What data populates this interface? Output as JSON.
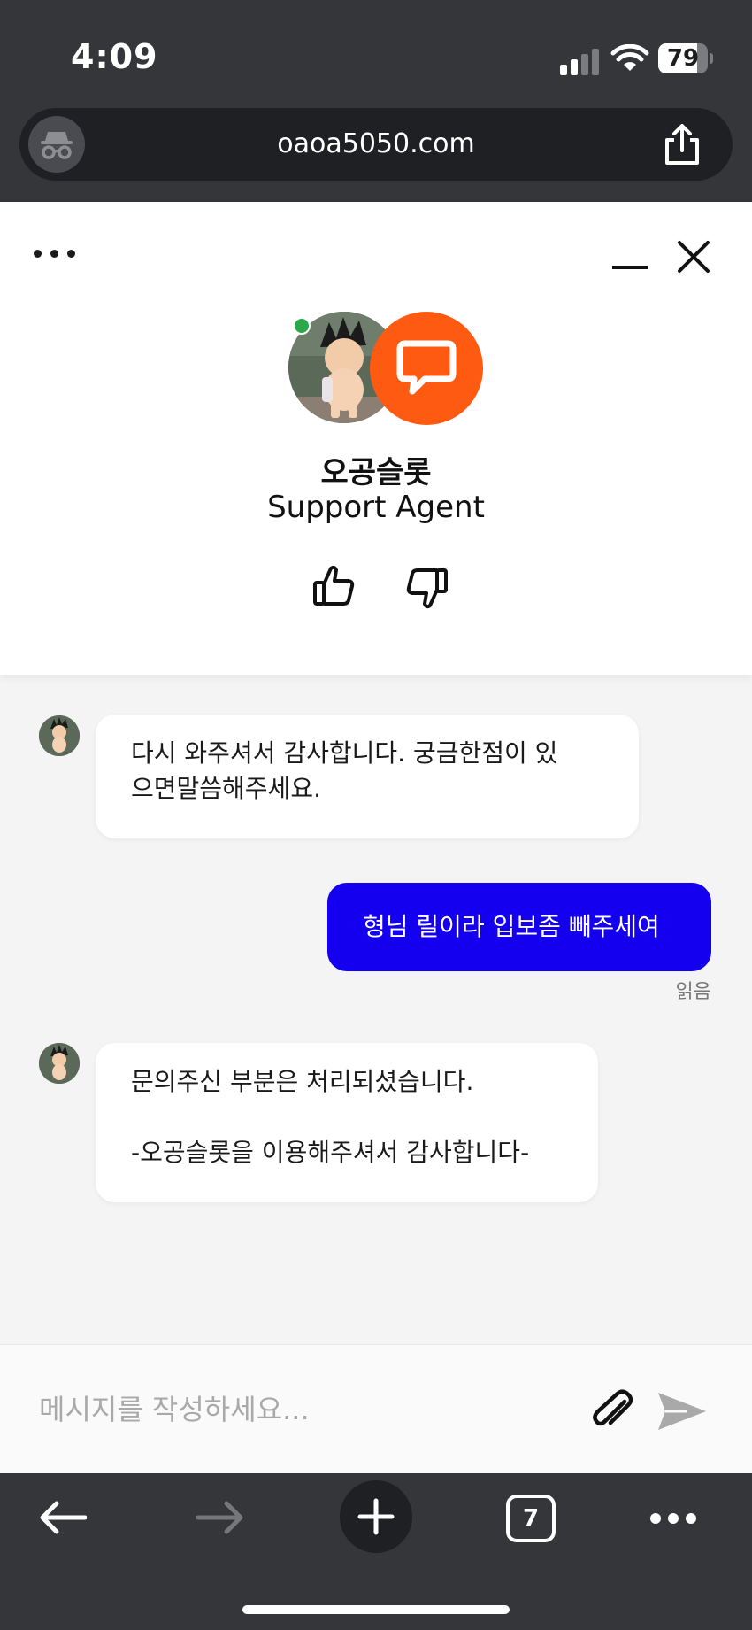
{
  "status_bar": {
    "time": "4:09",
    "battery_level": "79",
    "battery_fraction": 0.79
  },
  "browser": {
    "url": "oaoa5050.com",
    "incognito_icon": "incognito-icon",
    "share_icon": "share-icon",
    "open_tabs": "7"
  },
  "widget": {
    "agent_name": "오공슬롯",
    "agent_role": "Support Agent",
    "brand_color": "#ff5a12",
    "online_color": "#2aa84a"
  },
  "messages": [
    {
      "sender": "agent",
      "text": "다시 와주셔서 감사합니다. 궁금한점이 있\n으면말씀해주세요."
    },
    {
      "sender": "user",
      "text": "형님 릴이라 입보좀 빼주세여",
      "receipt": "읽음"
    },
    {
      "sender": "agent",
      "text": "문의주신 부분은 처리되셨습니다.\n\n-오공슬롯을 이용해주셔서 감사합니다-"
    }
  ],
  "composer": {
    "placeholder": "메시지를 작성하세요..."
  },
  "colors": {
    "user_bubble": "#1400ee",
    "browser_chrome": "#35363a"
  }
}
